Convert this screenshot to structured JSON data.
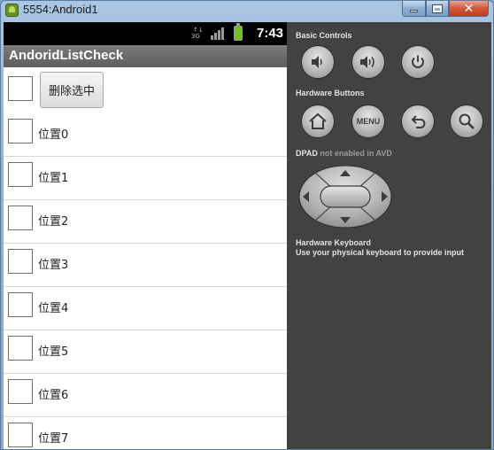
{
  "window": {
    "title": "5554:Android1",
    "minimize_label": "minimize",
    "maximize_label": "maximize",
    "close_glyph": "✕"
  },
  "statusbar": {
    "time": "7:43",
    "network_icon": "data-transfer-icon",
    "signal_icon": "signal-bars-icon",
    "battery_icon": "battery-icon",
    "battery_color": "#72c021"
  },
  "app": {
    "title": "AndoridListCheck",
    "delete_button": "删除选中",
    "items": [
      {
        "label": "位置0"
      },
      {
        "label": "位置1"
      },
      {
        "label": "位置2"
      },
      {
        "label": "位置3"
      },
      {
        "label": "位置4"
      },
      {
        "label": "位置5"
      },
      {
        "label": "位置6"
      },
      {
        "label": "位置7"
      }
    ]
  },
  "controls": {
    "basic_controls_label": "Basic Controls",
    "hardware_buttons_label": "Hardware Buttons",
    "menu_label": "MENU",
    "dpad_label": "DPAD",
    "dpad_note": "not enabled in AVD",
    "keyboard_title": "Hardware Keyboard",
    "keyboard_note": "Use your physical keyboard to provide input"
  },
  "colors": {
    "panel_background": "#424242",
    "appbar": "#6b6b6b",
    "close_button": "#c8452b"
  }
}
